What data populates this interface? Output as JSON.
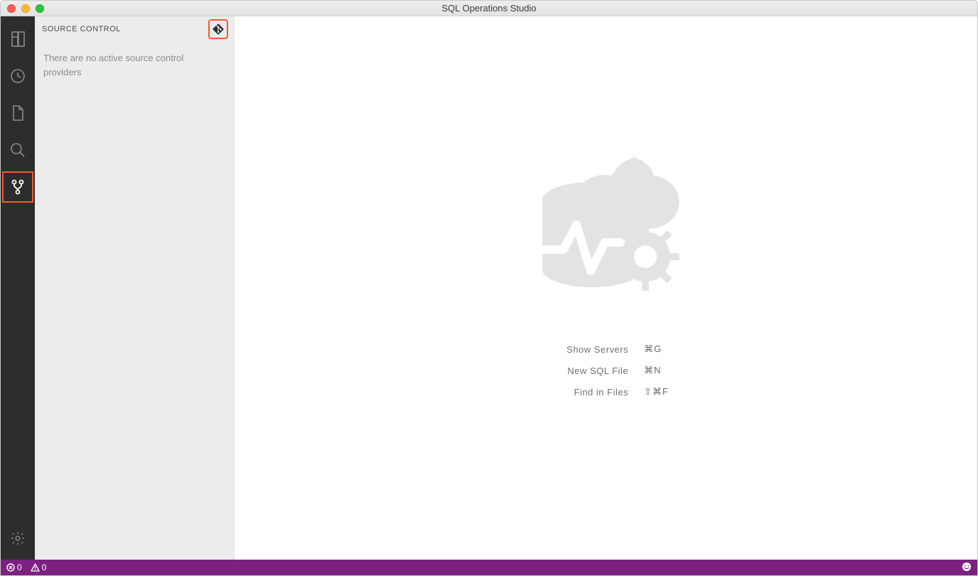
{
  "window": {
    "title": "SQL Operations Studio"
  },
  "sidebar": {
    "title": "SOURCE CONTROL",
    "message": "There are no active source control providers"
  },
  "welcome": {
    "commands": [
      {
        "label": "Show Servers",
        "shortcut": "⌘G"
      },
      {
        "label": "New SQL File",
        "shortcut": "⌘N"
      },
      {
        "label": "Find in Files",
        "shortcut": "⇧⌘F"
      }
    ]
  },
  "statusbar": {
    "errors": "0",
    "warnings": "0"
  },
  "icons": {
    "servers": "servers-icon",
    "history": "history-icon",
    "explorer": "explorer-icon",
    "search": "search-icon",
    "source_control": "source-control-icon",
    "settings": "gear-icon",
    "git": "git-icon",
    "smiley": "smiley-icon",
    "error": "error-icon",
    "warning": "warning-icon"
  }
}
